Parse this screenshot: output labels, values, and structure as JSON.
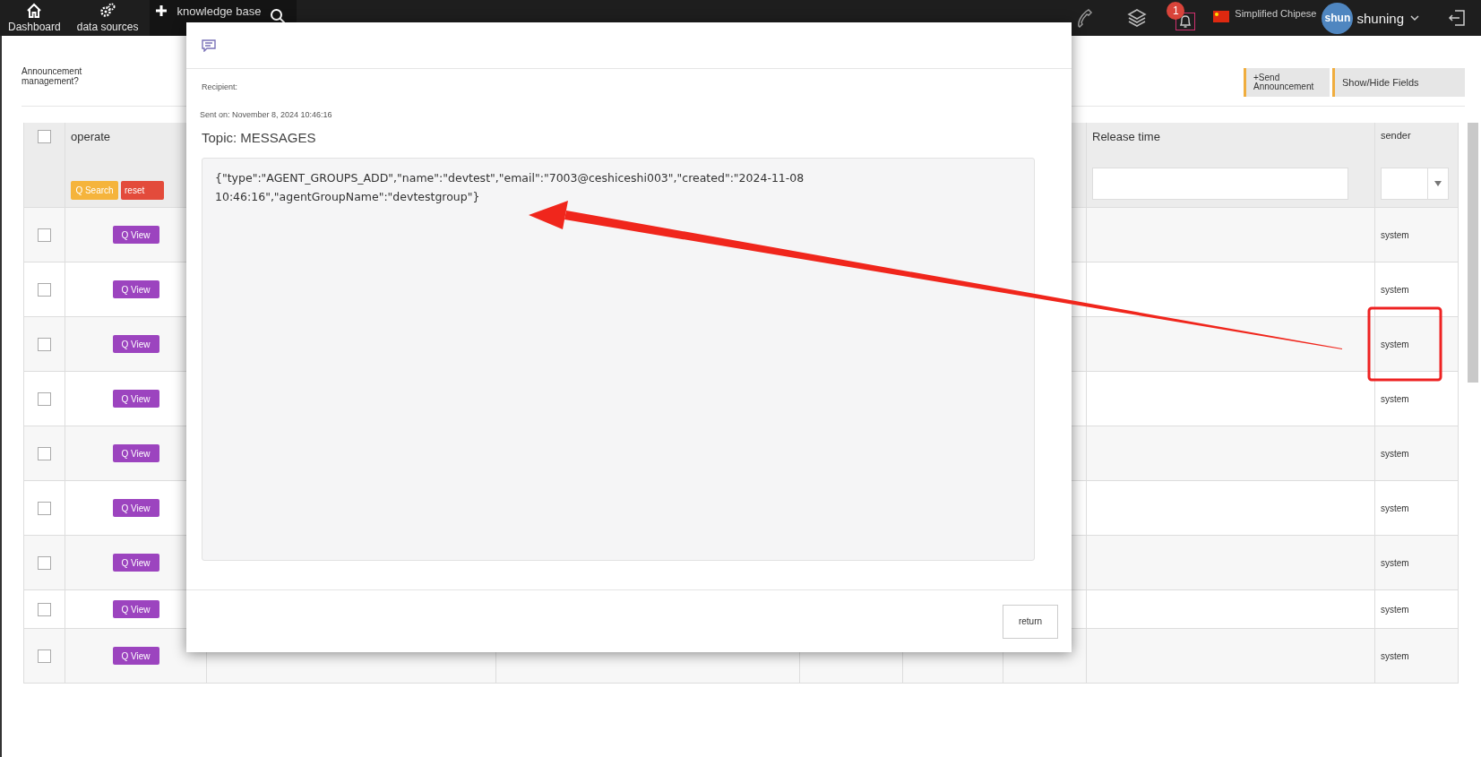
{
  "top_bar": {
    "nav": [
      {
        "kind": "home",
        "label": "Dashboard"
      },
      {
        "kind": "gears",
        "label": "data sources"
      },
      {
        "kind": "plus",
        "label": "knowledge base"
      }
    ],
    "notifications": "1",
    "language": "Simplified Chipese",
    "avatar": "shun",
    "user": "shuning"
  },
  "page": {
    "title": "Announcement management?",
    "buttons": [
      "+Send Announcement",
      "Show/Hide Fields"
    ]
  },
  "table": {
    "header_checked": false,
    "columns": [
      "operate",
      "Release time",
      "sender"
    ],
    "filter_buttons": [
      {
        "kind": "search",
        "label": "Q Search"
      },
      {
        "kind": "reset",
        "label": "reset"
      }
    ],
    "rows": [
      {
        "checked": false,
        "action": "Q View",
        "sender": "system"
      },
      {
        "checked": false,
        "action": "Q View",
        "sender": "system"
      },
      {
        "checked": false,
        "action": "Q View",
        "sender": "system"
      },
      {
        "checked": false,
        "action": "Q View",
        "sender": "system"
      },
      {
        "checked": false,
        "action": "Q View",
        "sender": "system"
      },
      {
        "checked": false,
        "action": "Q View",
        "sender": "system"
      },
      {
        "checked": false,
        "action": "Q View",
        "sender": "system"
      },
      {
        "checked": false,
        "action": "Q View",
        "sender": "system"
      },
      {
        "checked": false,
        "action": "Q View",
        "sender": "system"
      }
    ]
  },
  "dialog": {
    "recipient": "Recipient:",
    "sent_on": "Sent on: November 8, 2024 10:46:16",
    "topic": "Topic: MESSAGES",
    "body": "{\"type\":\"AGENT_GROUPS_ADD\",\"name\":\"devtest\",\"email\":\"7003@ceshiceshi003\",\"created\":\"2024-11-08 10:46:16\",\"agentGroupName\":\"devtestgroup\"}",
    "return_button": "return"
  }
}
